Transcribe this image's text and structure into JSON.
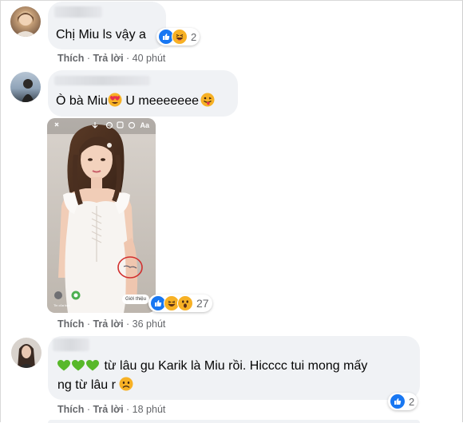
{
  "comments": [
    {
      "text": "Chị Miu ls vậy a",
      "reaction_count": "2",
      "like_label": "Thích",
      "reply_label": "Trả lời",
      "time": "40 phút"
    },
    {
      "text_before": "Ò bà Miu",
      "text_after": " U meeeeeee",
      "reaction_count": "27",
      "like_label": "Thích",
      "reply_label": "Trả lời",
      "time": "36 phút",
      "photo_button": "Giới thiệu",
      "photo_top_text": "Aa"
    },
    {
      "text_line1": " từ lâu gu Karik là Miu rồi. Hicccc tui mong mấy",
      "text_line2": "ng từ lâu r ",
      "reaction_count": "2",
      "like_label": "Thích",
      "reply_label": "Trả lời",
      "time": "18 phút"
    }
  ],
  "colors": {
    "bubble": "#f0f2f5",
    "like_blue": "#1877f2",
    "meta_gray": "#65676b",
    "heart_green": "#58b82a"
  },
  "icons": [
    "like-icon",
    "haha-icon",
    "wow-icon",
    "heart-eyes-icon",
    "tongue-face-icon",
    "green-heart-icon",
    "sad-face-icon"
  ]
}
